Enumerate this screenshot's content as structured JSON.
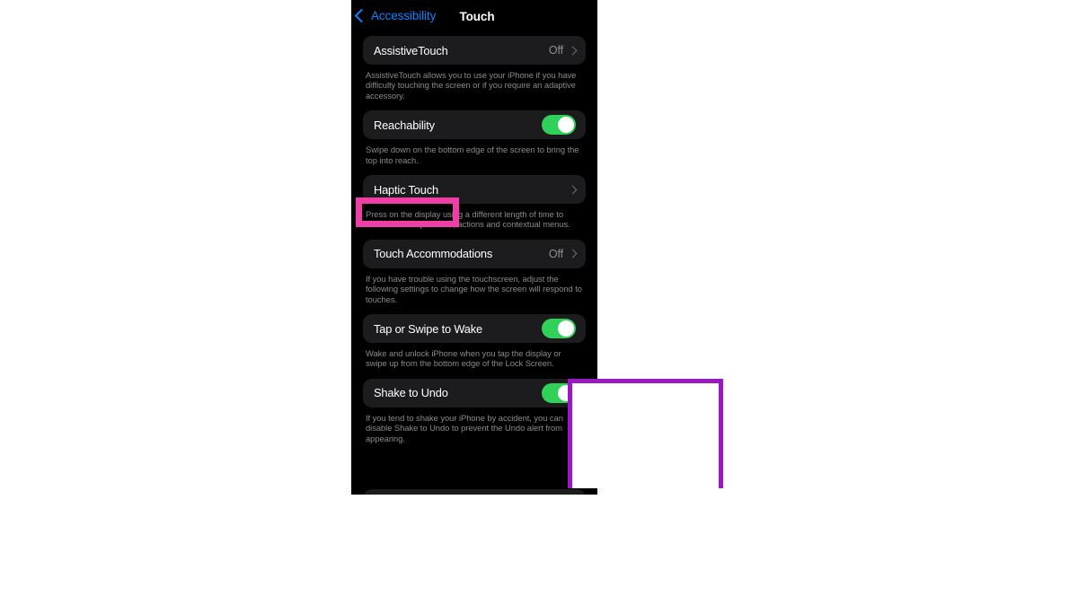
{
  "nav": {
    "back_label": "Accessibility",
    "back_icon": "chevron-left-icon",
    "title": "Touch"
  },
  "settings": {
    "groups": [
      {
        "id": "assistive-touch",
        "label": "AssistiveTouch",
        "value": "Off",
        "control": "disclosure",
        "description": "AssistiveTouch allows you to use your iPhone if you have difficulty touching the screen or if you require an adaptive accessory."
      },
      {
        "id": "reachability",
        "label": "Reachability",
        "value": "",
        "control": "toggle",
        "toggle_on": true,
        "description": "Swipe down on the bottom edge of the screen to bring the top into reach."
      },
      {
        "id": "haptic-touch",
        "label": "Haptic Touch",
        "value": "",
        "control": "disclosure",
        "highlighted": true,
        "description": "Press on the display using a different length of time to reveal content previews, actions and contextual menus."
      },
      {
        "id": "touch-accommodations",
        "label": "Touch Accommodations",
        "value": "Off",
        "control": "disclosure",
        "description": "If you have trouble using the touchscreen, adjust the following settings to change how the screen will respond to touches."
      },
      {
        "id": "tap-or-swipe-to-wake",
        "label": "Tap or Swipe to Wake",
        "value": "",
        "control": "toggle",
        "toggle_on": true,
        "description": "Wake and unlock iPhone when you tap the display or swipe up from the bottom edge of the Lock Screen."
      },
      {
        "id": "shake-to-undo",
        "label": "Shake to Undo",
        "value": "",
        "control": "toggle",
        "toggle_on": true,
        "description": "If you tend to shake your iPhone by accident, you can disable Shake to Undo to prevent the Undo alert from appearing."
      }
    ]
  },
  "annotations": {
    "highlight_color": "#ef3fa7",
    "callout_border_color": "#9b19c4",
    "callout_fill_color": "#ffffff",
    "highlight_target": "Haptic Touch"
  },
  "colors": {
    "screen_background": "#000000",
    "row_background": "#1c1c1e",
    "accent_link": "#0a84ff",
    "toggle_on": "#30d158",
    "secondary_text": "#8a8a8e"
  }
}
